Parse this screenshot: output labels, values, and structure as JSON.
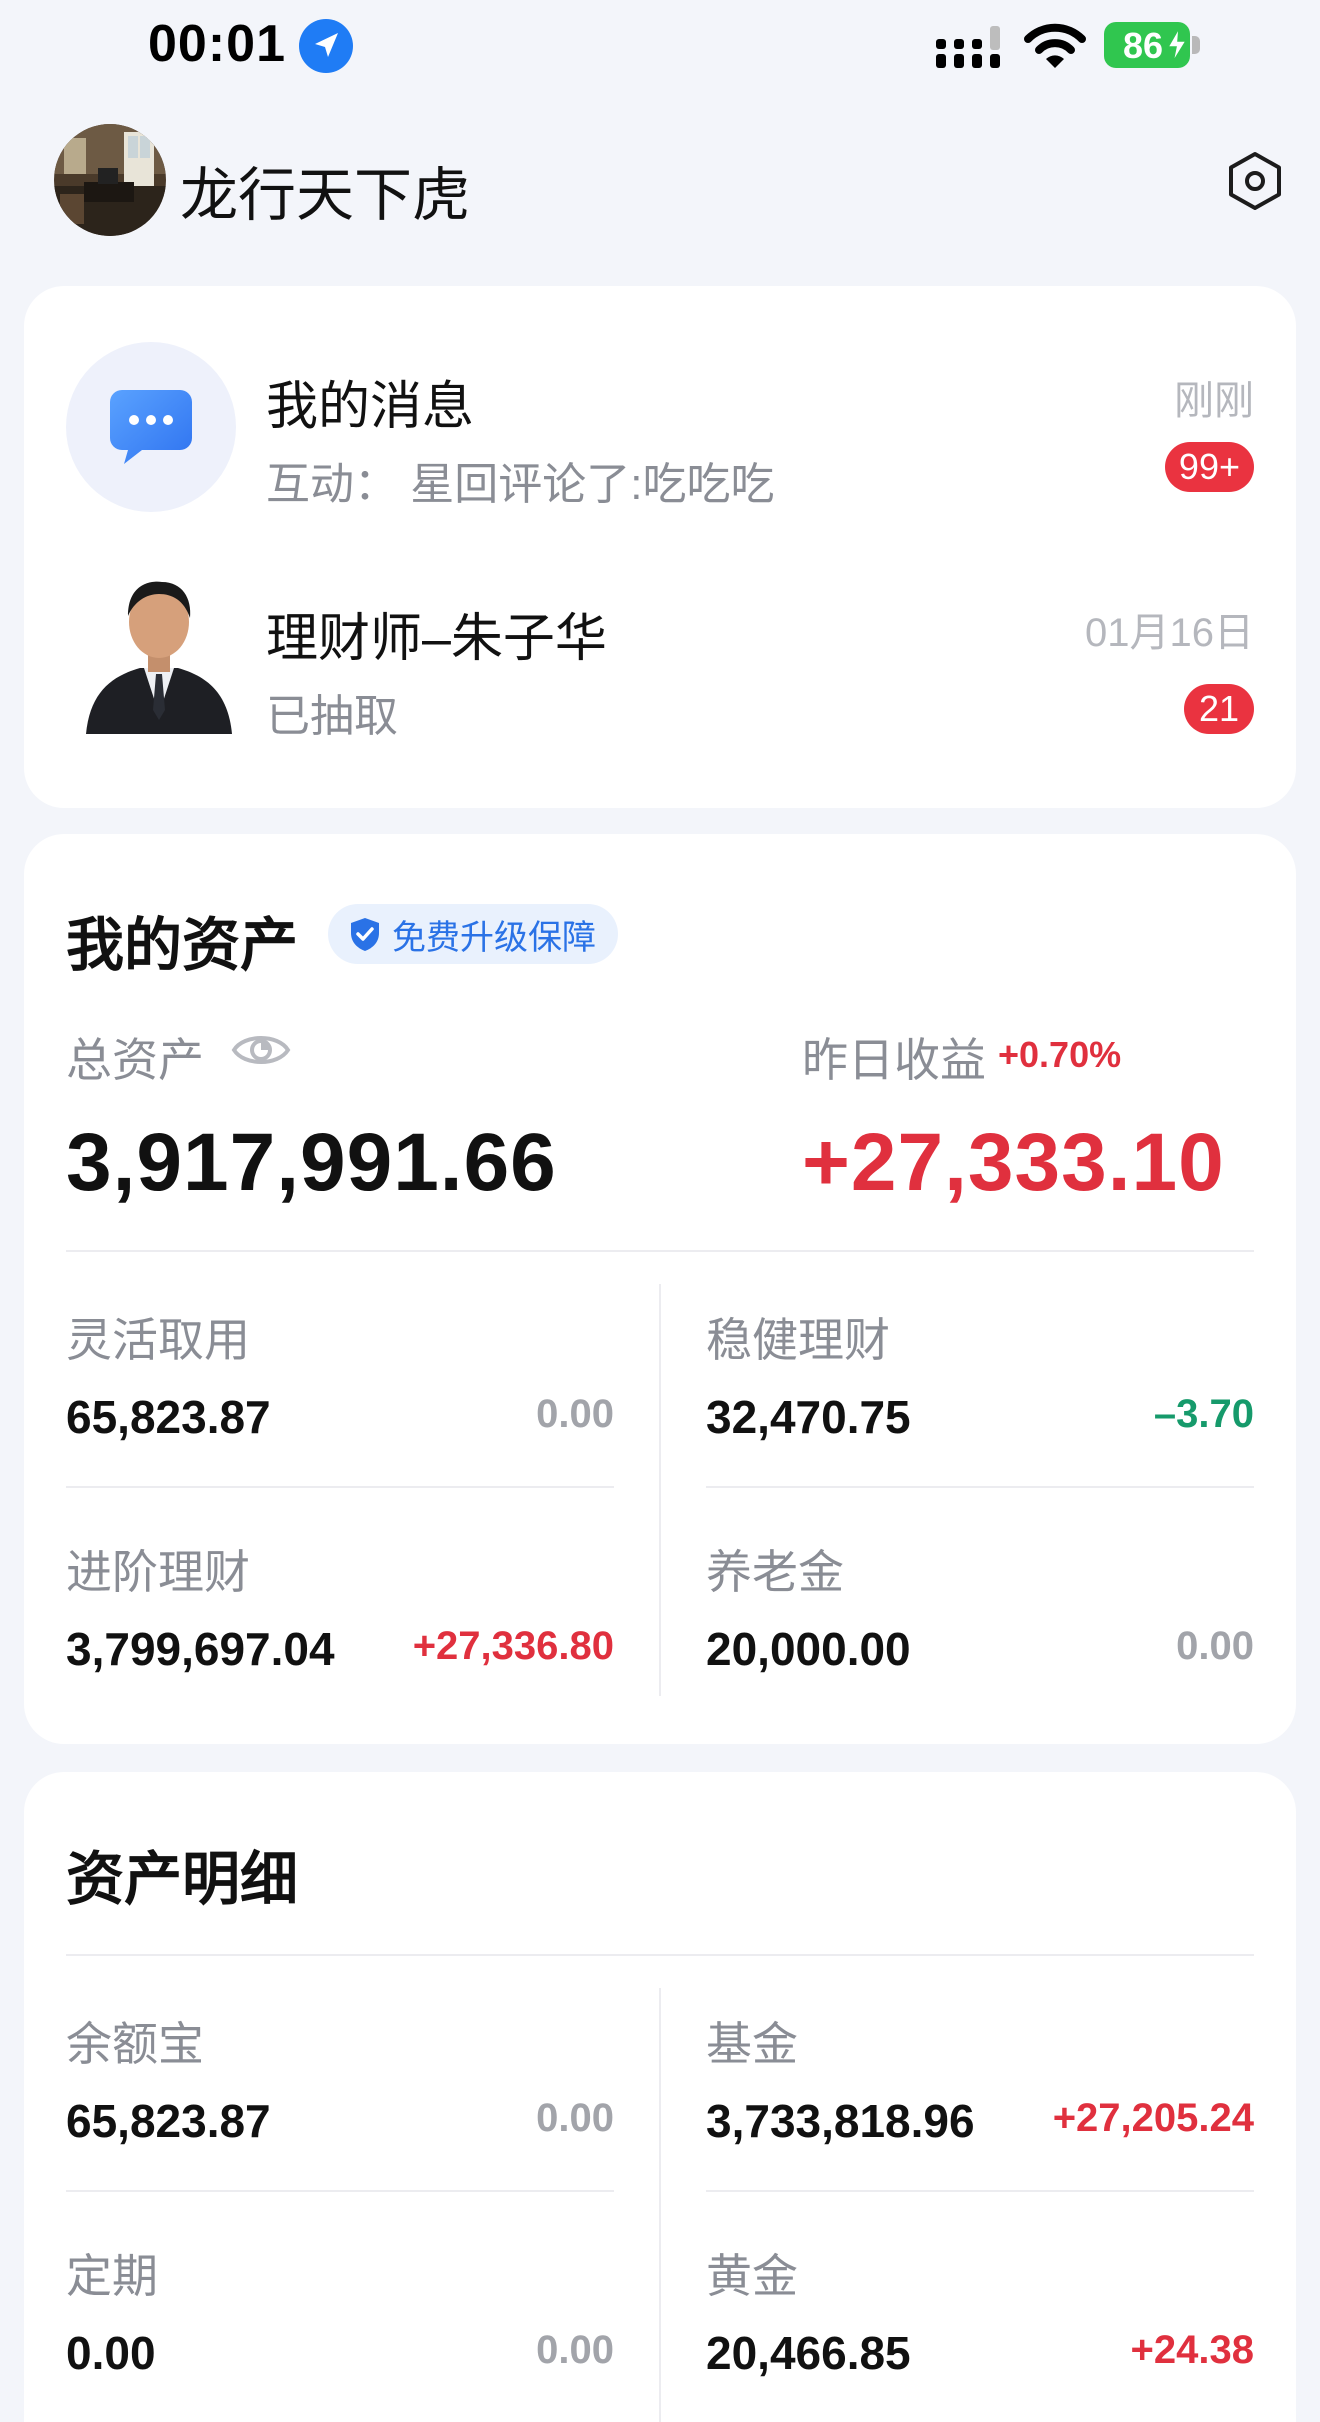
{
  "status_bar": {
    "time": "00:01",
    "battery": "86",
    "icons": [
      "location-arrow-icon",
      "cellular-signal-icon",
      "wifi-icon",
      "battery-charging-icon"
    ]
  },
  "header": {
    "username": "龙行天下虎",
    "icons": [
      "avatar",
      "settings-hexagon-icon"
    ]
  },
  "messages": [
    {
      "title": "我的消息",
      "subtitle": "互动：  星回评论了:吃吃吃",
      "time": "刚刚",
      "badge": "99+",
      "icon": "chat-bubble-icon"
    },
    {
      "title": "理财师–朱子华",
      "subtitle": "已抽取",
      "time": "01月16日",
      "badge": "21",
      "icon": "advisor-avatar"
    }
  ],
  "assets": {
    "title": "我的资产",
    "guarantee_badge": "免费升级保障",
    "total_label": "总资产",
    "total_value": "3,917,991.66",
    "yesterday_label": "昨日收益",
    "yesterday_rate": "+0.70%",
    "yesterday_value": "+27,333.10",
    "items": [
      {
        "label": "灵活取用",
        "value": "65,823.87",
        "change": "0.00"
      },
      {
        "label": "稳健理财",
        "value": "32,470.75",
        "change": "–3.70"
      },
      {
        "label": "进阶理财",
        "value": "3,799,697.04",
        "change": "+27,336.80"
      },
      {
        "label": "养老金",
        "value": "20,000.00",
        "change": "0.00"
      }
    ]
  },
  "detail": {
    "title": "资产明细",
    "items": [
      {
        "label": "余额宝",
        "value": "65,823.87",
        "change": "0.00"
      },
      {
        "label": "基金",
        "value": "3,733,818.96",
        "change": "+27,205.24"
      },
      {
        "label": "定期",
        "value": "0.00",
        "change": "0.00"
      },
      {
        "label": "黄金",
        "value": "20,466.85",
        "change": "+24.38"
      }
    ]
  },
  "colors": {
    "background": "#f3f5fa",
    "positive": "#e0303e",
    "negative": "#169a6b",
    "neutral": "#a2a4aa",
    "badge": "#ea3340",
    "accent_blue": "#2a72e6",
    "battery_green": "#30c64f"
  }
}
